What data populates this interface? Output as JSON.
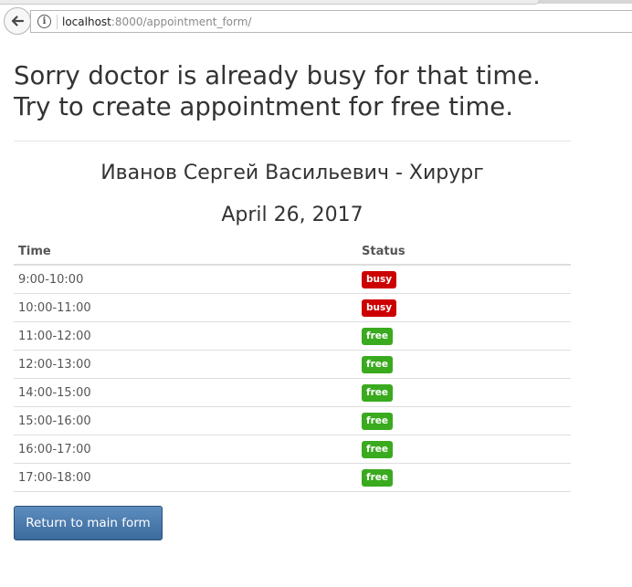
{
  "browser": {
    "url_host": "localhost",
    "url_path": ":8000/appointment_form/"
  },
  "page": {
    "heading_line1": "Sorry doctor is already busy for that time.",
    "heading_line2": "Try to create appointment for free time.",
    "doctor": "Иванов Сергей Васильевич - Хирург",
    "date": "April 26, 2017"
  },
  "table": {
    "headers": {
      "time": "Time",
      "status": "Status"
    },
    "rows": [
      {
        "time": "9:00-10:00",
        "status": "busy"
      },
      {
        "time": "10:00-11:00",
        "status": "busy"
      },
      {
        "time": "11:00-12:00",
        "status": "free"
      },
      {
        "time": "12:00-13:00",
        "status": "free"
      },
      {
        "time": "14:00-15:00",
        "status": "free"
      },
      {
        "time": "15:00-16:00",
        "status": "free"
      },
      {
        "time": "16:00-17:00",
        "status": "free"
      },
      {
        "time": "17:00-18:00",
        "status": "free"
      }
    ]
  },
  "colors": {
    "busy": "#cc0000",
    "free": "#3aaa1e",
    "button": "#3b6a9c"
  },
  "icons": {
    "back": "back-arrow-icon",
    "info": "info-icon"
  },
  "actions": {
    "return_label": "Return to main form"
  }
}
